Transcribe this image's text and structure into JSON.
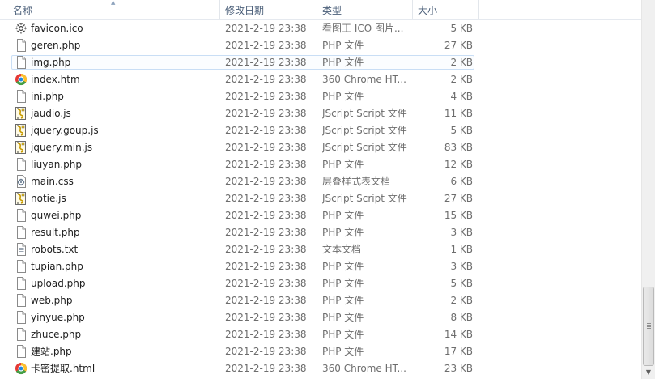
{
  "columns": {
    "name": "名称",
    "date": "修改日期",
    "type": "类型",
    "size": "大小"
  },
  "files": [
    {
      "name": "favicon.ico",
      "date": "2021-2-19 23:38",
      "type": "看图王 ICO 图片...",
      "size": "5 KB",
      "icon": "ico-file-icon"
    },
    {
      "name": "geren.php",
      "date": "2021-2-19 23:38",
      "type": "PHP 文件",
      "size": "27 KB",
      "icon": "blank-file-icon"
    },
    {
      "name": "img.php",
      "date": "2021-2-19 23:38",
      "type": "PHP 文件",
      "size": "2 KB",
      "icon": "blank-file-icon"
    },
    {
      "name": "index.htm",
      "date": "2021-2-19 23:38",
      "type": "360 Chrome HT...",
      "size": "2 KB",
      "icon": "browser-html-icon"
    },
    {
      "name": "ini.php",
      "date": "2021-2-19 23:38",
      "type": "PHP 文件",
      "size": "4 KB",
      "icon": "blank-file-icon"
    },
    {
      "name": "jaudio.js",
      "date": "2021-2-19 23:38",
      "type": "JScript Script 文件",
      "size": "11 KB",
      "icon": "script-file-icon"
    },
    {
      "name": "jquery.goup.js",
      "date": "2021-2-19 23:38",
      "type": "JScript Script 文件",
      "size": "5 KB",
      "icon": "script-file-icon"
    },
    {
      "name": "jquery.min.js",
      "date": "2021-2-19 23:38",
      "type": "JScript Script 文件",
      "size": "83 KB",
      "icon": "script-file-icon"
    },
    {
      "name": "liuyan.php",
      "date": "2021-2-19 23:38",
      "type": "PHP 文件",
      "size": "12 KB",
      "icon": "blank-file-icon"
    },
    {
      "name": "main.css",
      "date": "2021-2-19 23:38",
      "type": "层叠样式表文档",
      "size": "6 KB",
      "icon": "css-file-icon"
    },
    {
      "name": "notie.js",
      "date": "2021-2-19 23:38",
      "type": "JScript Script 文件",
      "size": "27 KB",
      "icon": "script-file-icon"
    },
    {
      "name": "quwei.php",
      "date": "2021-2-19 23:38",
      "type": "PHP 文件",
      "size": "15 KB",
      "icon": "blank-file-icon"
    },
    {
      "name": "result.php",
      "date": "2021-2-19 23:38",
      "type": "PHP 文件",
      "size": "3 KB",
      "icon": "blank-file-icon"
    },
    {
      "name": "robots.txt",
      "date": "2021-2-19 23:38",
      "type": "文本文档",
      "size": "1 KB",
      "icon": "text-file-icon"
    },
    {
      "name": "tupian.php",
      "date": "2021-2-19 23:38",
      "type": "PHP 文件",
      "size": "3 KB",
      "icon": "blank-file-icon"
    },
    {
      "name": "upload.php",
      "date": "2021-2-19 23:38",
      "type": "PHP 文件",
      "size": "5 KB",
      "icon": "blank-file-icon"
    },
    {
      "name": "web.php",
      "date": "2021-2-19 23:38",
      "type": "PHP 文件",
      "size": "2 KB",
      "icon": "blank-file-icon"
    },
    {
      "name": "yinyue.php",
      "date": "2021-2-19 23:38",
      "type": "PHP 文件",
      "size": "8 KB",
      "icon": "blank-file-icon"
    },
    {
      "name": "zhuce.php",
      "date": "2021-2-19 23:38",
      "type": "PHP 文件",
      "size": "14 KB",
      "icon": "blank-file-icon"
    },
    {
      "name": "建站.php",
      "date": "2021-2-19 23:38",
      "type": "PHP 文件",
      "size": "17 KB",
      "icon": "blank-file-icon"
    },
    {
      "name": "卡密提取.html",
      "date": "2021-2-19 23:38",
      "type": "360 Chrome HT...",
      "size": "23 KB",
      "icon": "browser-html-icon"
    }
  ],
  "focused_file": "img.php",
  "colors": {
    "header_text": "#4c607a",
    "detail_text": "#6d6d6d",
    "focus_border": "#c9def5"
  }
}
